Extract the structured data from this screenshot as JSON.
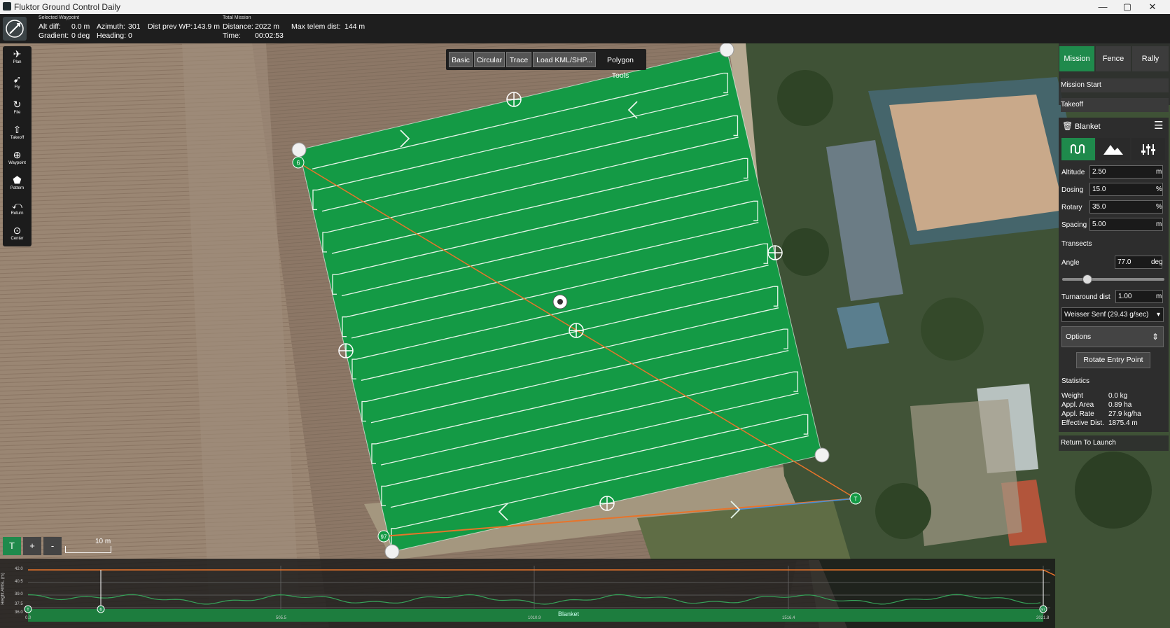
{
  "window": {
    "title": "Fluktor Ground Control Daily",
    "controls": [
      "—",
      "▢",
      "✕"
    ]
  },
  "toolbar": {
    "selected_waypoint_label": "Selected Waypoint",
    "alt_diff_label": "Alt diff:",
    "alt_diff_value": "0.0 m",
    "gradient_label": "Gradient:",
    "gradient_value": "0 deg",
    "azimuth_label": "Azimuth:",
    "azimuth_value": "301",
    "heading_label": "Heading:",
    "heading_value": "0",
    "dist_prev_label": "Dist prev WP:",
    "dist_prev_value": "143.9 m",
    "total_mission_label": "Total Mission",
    "distance_label": "Distance:",
    "distance_value": "2022 m",
    "time_label": "Time:",
    "time_value": "00:02:53",
    "max_telem_label": "Max telem dist:",
    "max_telem_value": "144 m"
  },
  "leftbar": {
    "items": [
      {
        "label": "Plan",
        "icon": "plan-icon"
      },
      {
        "label": "Fly",
        "icon": "fly-icon"
      },
      {
        "label": "File",
        "icon": "sync-icon"
      },
      {
        "label": "Takeoff",
        "icon": "takeoff-icon"
      },
      {
        "label": "Waypoint",
        "icon": "waypoint-icon"
      },
      {
        "label": "Pattern",
        "icon": "pattern-icon"
      },
      {
        "label": "Return",
        "icon": "return-icon"
      },
      {
        "label": "Center",
        "icon": "center-icon"
      }
    ]
  },
  "pattern_tools": {
    "basic": "Basic",
    "circular": "Circular",
    "trace": "Trace",
    "load_kml": "Load KML/SHP...",
    "polygon_tools": "Polygon Tools"
  },
  "right_panel": {
    "tabs": {
      "mission": "Mission",
      "fence": "Fence",
      "rally": "Rally"
    },
    "mission_start": "Mission Start",
    "takeoff": "Takeoff",
    "section_title": "Blanket",
    "altitude_label": "Altitude",
    "altitude_value": "2.50",
    "altitude_unit": "m",
    "dosing_label": "Dosing",
    "dosing_value": "15.0",
    "dosing_unit": "%",
    "rotary_label": "Rotary",
    "rotary_value": "35.0",
    "rotary_unit": "%",
    "spacing_label": "Spacing",
    "spacing_value": "5.00",
    "spacing_unit": "m",
    "transects_label": "Transects",
    "angle_label": "Angle",
    "angle_value": "77.0",
    "angle_unit": "deg",
    "turnaround_label": "Turnaround dist",
    "turnaround_value": "1.00",
    "turnaround_unit": "m",
    "product_select": "Weisser Senf (29.43 g/sec)",
    "options_label": "Options",
    "rotate_button": "Rotate Entry Point",
    "statistics_label": "Statistics",
    "weight_label": "Weight",
    "weight_value": "0.0 kg",
    "appl_area_label": "Appl. Area",
    "appl_area_value": "0.89 ha",
    "appl_rate_label": "Appl. Rate",
    "appl_rate_value": "27.9 kg/ha",
    "eff_dist_label": "Effective Dist.",
    "eff_dist_value": "1875.4 m",
    "return_to_launch": "Return To Launch"
  },
  "map": {
    "scale_label": "10 m",
    "waypoint_first": "6",
    "waypoint_last": "97",
    "home_label": "T"
  },
  "map_controls": {
    "takeoff_label": "T",
    "zoom_in": "+",
    "zoom_out": "-"
  },
  "elevation": {
    "y_axis_label": "Height AMSL (m)",
    "y_ticks": [
      "42.0",
      "40.5",
      "39.0",
      "37.5",
      "36.0"
    ],
    "x_ticks": [
      "0.0",
      "505.5",
      "1010.9",
      "1516.4",
      "2021.8"
    ],
    "pattern_label": "Blanket",
    "start_marker": "T",
    "first_marker": "6",
    "end_marker": "97"
  },
  "colors": {
    "field_green": "#149a45",
    "accent_green": "#1f8a4c",
    "path_orange": "#e8742a",
    "panel_dark": "#2d2d2d"
  }
}
